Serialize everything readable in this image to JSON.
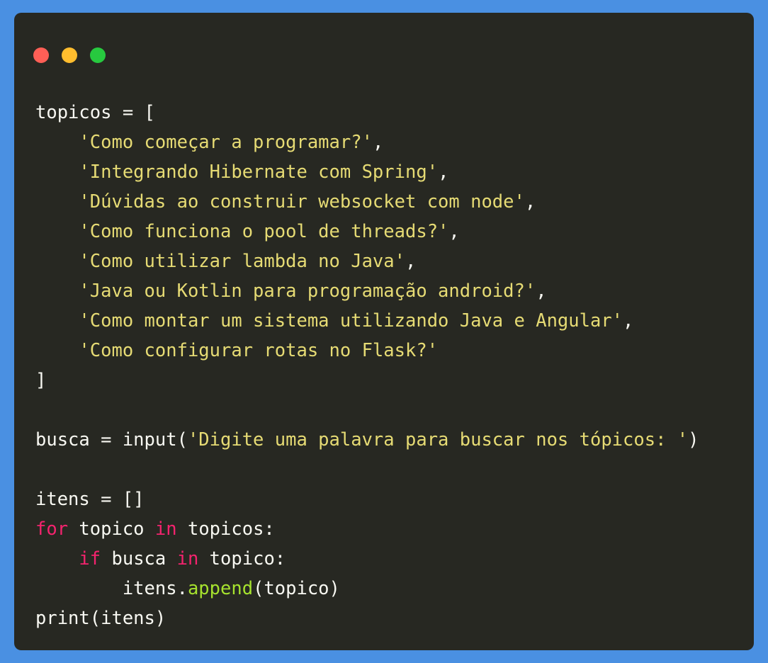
{
  "window": {
    "background_color": "#272822",
    "border_color": "#4a90e2",
    "traffic_lights": [
      {
        "name": "close",
        "color": "#ff5f56"
      },
      {
        "name": "minimize",
        "color": "#ffbd2e"
      },
      {
        "name": "maximize",
        "color": "#27c93f"
      }
    ]
  },
  "theme": {
    "text_color": "#f8f8f2",
    "string_color": "#e6db74",
    "keyword_color": "#f4236e",
    "function_color": "#a6e22e"
  },
  "code": {
    "language": "python",
    "lines": [
      {
        "n": 1,
        "tokens": [
          {
            "t": "topicos = [",
            "c": "pln"
          }
        ]
      },
      {
        "n": 2,
        "tokens": [
          {
            "t": "    ",
            "c": "pln"
          },
          {
            "t": "'Como começar a programar?'",
            "c": "str"
          },
          {
            "t": ",",
            "c": "pln"
          }
        ]
      },
      {
        "n": 3,
        "tokens": [
          {
            "t": "    ",
            "c": "pln"
          },
          {
            "t": "'Integrando Hibernate com Spring'",
            "c": "str"
          },
          {
            "t": ",",
            "c": "pln"
          }
        ]
      },
      {
        "n": 4,
        "tokens": [
          {
            "t": "    ",
            "c": "pln"
          },
          {
            "t": "'Dúvidas ao construir websocket com node'",
            "c": "str"
          },
          {
            "t": ",",
            "c": "pln"
          }
        ]
      },
      {
        "n": 5,
        "tokens": [
          {
            "t": "    ",
            "c": "pln"
          },
          {
            "t": "'Como funciona o pool de threads?'",
            "c": "str"
          },
          {
            "t": ",",
            "c": "pln"
          }
        ]
      },
      {
        "n": 6,
        "tokens": [
          {
            "t": "    ",
            "c": "pln"
          },
          {
            "t": "'Como utilizar lambda no Java'",
            "c": "str"
          },
          {
            "t": ",",
            "c": "pln"
          }
        ]
      },
      {
        "n": 7,
        "tokens": [
          {
            "t": "    ",
            "c": "pln"
          },
          {
            "t": "'Java ou Kotlin para programação android?'",
            "c": "str"
          },
          {
            "t": ",",
            "c": "pln"
          }
        ]
      },
      {
        "n": 8,
        "tokens": [
          {
            "t": "    ",
            "c": "pln"
          },
          {
            "t": "'Como montar um sistema utilizando Java e Angular'",
            "c": "str"
          },
          {
            "t": ",",
            "c": "pln"
          }
        ]
      },
      {
        "n": 9,
        "tokens": [
          {
            "t": "    ",
            "c": "pln"
          },
          {
            "t": "'Como configurar rotas no Flask?'",
            "c": "str"
          }
        ]
      },
      {
        "n": 10,
        "tokens": [
          {
            "t": "]",
            "c": "pln"
          }
        ]
      },
      {
        "n": 11,
        "tokens": []
      },
      {
        "n": 12,
        "tokens": [
          {
            "t": "busca = input(",
            "c": "pln"
          },
          {
            "t": "'Digite uma palavra para buscar nos tópicos: '",
            "c": "str"
          },
          {
            "t": ")",
            "c": "pln"
          }
        ]
      },
      {
        "n": 13,
        "tokens": []
      },
      {
        "n": 14,
        "tokens": [
          {
            "t": "itens = []",
            "c": "pln"
          }
        ]
      },
      {
        "n": 15,
        "tokens": [
          {
            "t": "for",
            "c": "kw"
          },
          {
            "t": " topico ",
            "c": "pln"
          },
          {
            "t": "in",
            "c": "kw"
          },
          {
            "t": " topicos:",
            "c": "pln"
          }
        ]
      },
      {
        "n": 16,
        "tokens": [
          {
            "t": "    ",
            "c": "pln"
          },
          {
            "t": "if",
            "c": "kw"
          },
          {
            "t": " busca ",
            "c": "pln"
          },
          {
            "t": "in",
            "c": "kw"
          },
          {
            "t": " topico:",
            "c": "pln"
          }
        ]
      },
      {
        "n": 17,
        "tokens": [
          {
            "t": "        itens.",
            "c": "pln"
          },
          {
            "t": "append",
            "c": "fn"
          },
          {
            "t": "(topico)",
            "c": "pln"
          }
        ]
      },
      {
        "n": 18,
        "tokens": [
          {
            "t": "print(itens)",
            "c": "pln"
          }
        ]
      }
    ]
  }
}
